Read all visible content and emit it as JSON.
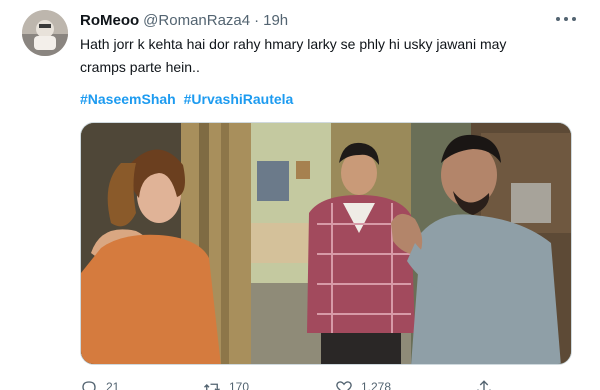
{
  "author": {
    "display_name": "RoMeoo",
    "handle": "@RomanRaza4",
    "time": "19h",
    "separator": "·"
  },
  "tweet": {
    "text": "Hath jorr k kehta hai dor rahy hmary larky se phly hi usky jawani may cramps parte hein..",
    "hashtags": [
      "#NaseemShah",
      "#UrvashiRautela"
    ]
  },
  "actions": {
    "reply_count": "21",
    "retweet_count": "170",
    "like_count": "1,278"
  },
  "icons": {
    "avatar": "avatar",
    "more": "more-dots-icon",
    "reply": "reply-icon",
    "retweet": "retweet-icon",
    "like": "heart-icon",
    "share": "share-icon"
  },
  "colors": {
    "link": "#1d9bf0",
    "secondary_text": "#536471",
    "primary_text": "#0f1419"
  }
}
